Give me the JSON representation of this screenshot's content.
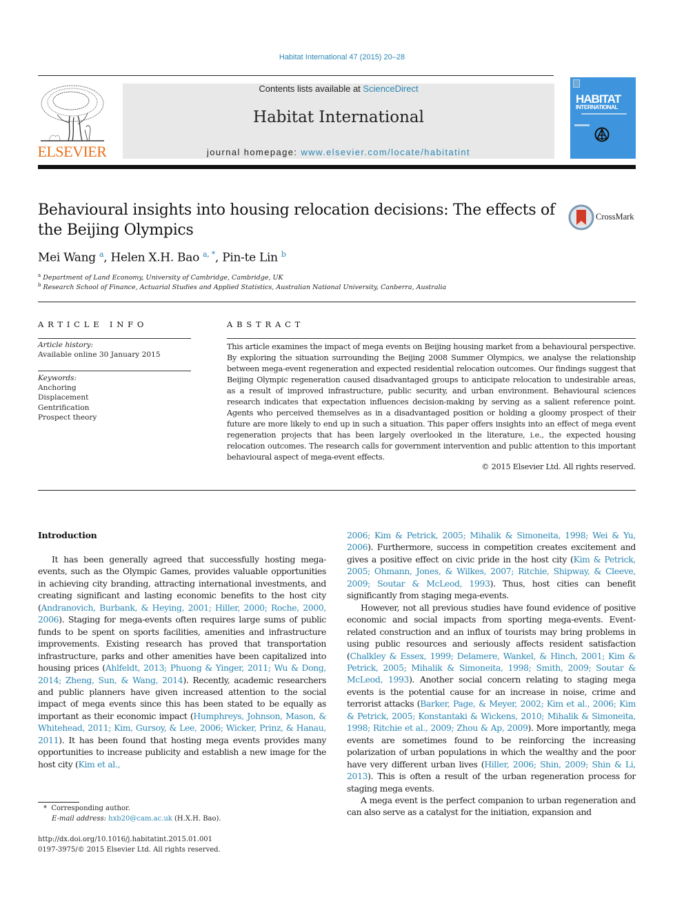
{
  "running_head": "Habitat International 47 (2015) 20–28",
  "masthead": {
    "publisher_logo_text": "ELSEVIER",
    "contents_prefix": "Contents lists available at ",
    "contents_link": "ScienceDirect",
    "journal_name": "Habitat International",
    "homepage_prefix": "journal homepage: ",
    "homepage_link": "www.elsevier.com/locate/habitatint",
    "cover_title": "HABITAT",
    "cover_subtitle": "INTERNATIONAL",
    "colors": {
      "link": "#2a86b2",
      "elsevier_orange": "#e9711c",
      "cover_blue": "#3f95dd",
      "masthead_gray": "#e8e8e8"
    }
  },
  "article": {
    "title_line1": "Behavioural insights into housing relocation decisions: The effects of",
    "title_line2": "the Beijing Olympics",
    "crossmark_label": "CrossMark",
    "authors": [
      {
        "name": "Mei Wang",
        "sup": "a",
        "sep": ", "
      },
      {
        "name": "Helen X.H. Bao",
        "sup": "a, *",
        "sep": ", "
      },
      {
        "name": "Pin-te Lin",
        "sup": "b",
        "sep": ""
      }
    ],
    "affiliations": [
      {
        "mark": "a",
        "text": "Department of Land Economy, University of Cambridge, Cambridge, UK"
      },
      {
        "mark": "b",
        "text": "Research School of Finance, Actuarial Studies and Applied Statistics, Australian National University, Canberra, Australia"
      }
    ]
  },
  "article_info": {
    "heading": "ARTICLE INFO",
    "history_label": "Article history:",
    "history_value": "Available online 30 January 2015",
    "keywords_label": "Keywords:",
    "keywords": [
      "Anchoring",
      "Displacement",
      "Gentrification",
      "Prospect theory"
    ]
  },
  "abstract": {
    "heading": "ABSTRACT",
    "text": "This article examines the impact of mega events on Beijing housing market from a behavioural perspective. By exploring the situation surrounding the Beijing 2008 Summer Olympics, we analyse the relationship between mega-event regeneration and expected residential relocation outcomes. Our findings suggest that Beijing Olympic regeneration caused disadvantaged groups to anticipate relocation to undesirable areas, as a result of improved infrastructure, public security, and urban environment. Behavioural sciences research indicates that expectation influences decision-making by serving as a salient reference point. Agents who perceived themselves as in a disadvantaged position or holding a gloomy prospect of their future are more likely to end up in such a situation. This paper offers insights into an effect of mega event regeneration projects that has been largely overlooked in the literature, i.e., the expected housing relocation outcomes. The research calls for government intervention and public attention to this important behavioural aspect of mega-event effects.",
    "copyright": "© 2015 Elsevier Ltd. All rights reserved."
  },
  "introduction": {
    "heading": "Introduction",
    "left_paragraph": [
      {
        "t": "It has been generally agreed that successfully hosting mega-events, such as the Olympic Games, provides valuable opportunities in achieving city branding, attracting international investments, and creating significant and lasting economic benefits to the host city ("
      },
      {
        "c": "Andranovich, Burbank, & Heying, 2001; Hiller, 2000; Roche, 2000, 2006"
      },
      {
        "t": "). Staging for mega-events often requires large sums of public funds to be spent on sports facilities, amenities and infrastructure improvements. Existing research has proved that transportation infrastructure, parks and other amenities have been capitalized into housing prices ("
      },
      {
        "c": "Ahlfeldt, 2013; Phuong & Yinger, 2011; Wu & Dong, 2014; Zheng, Sun, & Wang, 2014"
      },
      {
        "t": "). Recently, academic researchers and public planners have given increased attention to the social impact of mega events since this has been stated to be equally as important as their economic impact ("
      },
      {
        "c": "Humphreys, Johnson, Mason, & Whitehead, 2011; Kim, Gursoy, & Lee, 2006; Wicker, Prinz, & Hanau, 2011"
      },
      {
        "t": "). It has been found that hosting mega events provides many opportunities to increase publicity and establish a new image for the host city ("
      },
      {
        "c": "Kim et al.,"
      }
    ],
    "right_paragraphs": [
      [
        {
          "c": "2006; Kim & Petrick, 2005; Mihalik & Simoneita, 1998; Wei & Yu, 2006"
        },
        {
          "t": "). Furthermore, success in competition creates excitement and gives a positive effect on civic pride in the host city ("
        },
        {
          "c": "Kim & Petrick, 2005; Ohmann, Jones, & Wilkes, 2007; Ritchie, Shipway, & Cleeve, 2009; Soutar & McLeod, 1993"
        },
        {
          "t": "). Thus, host cities can benefit significantly from staging mega-events."
        }
      ],
      [
        {
          "t": "However, not all previous studies have found evidence of positive economic and social impacts from sporting mega-events. Event-related construction and an influx of tourists may bring problems in using public resources and seriously affects resident satisfaction ("
        },
        {
          "c": "Chalkley & Essex, 1999; Delamere, Wankel, & Hinch, 2001; Kim & Petrick, 2005; Mihalik & Simoneita, 1998; Smith, 2009; Soutar & McLeod, 1993"
        },
        {
          "t": "). Another social concern relating to staging mega events is the potential cause for an increase in noise, crime and terrorist attacks ("
        },
        {
          "c": "Barker, Page, & Meyer, 2002; Kim et al., 2006; Kim & Petrick, 2005; Konstantaki & Wickens, 2010; Mihalik & Simoneita, 1998; Ritchie et al., 2009; Zhou & Ap, 2009"
        },
        {
          "t": "). More importantly, mega events are sometimes found to be reinforcing the increasing polarization of urban populations in which the wealthy and the poor have very different urban lives ("
        },
        {
          "c": "Hiller, 2006; Shin, 2009; Shin & Li, 2013"
        },
        {
          "t": "). This is often a result of the urban regeneration process for staging mega events."
        }
      ],
      [
        {
          "t": "A mega event is the perfect companion to urban regeneration and can also serve as a catalyst for the initiation, expansion and"
        }
      ]
    ]
  },
  "footnotes": {
    "corresponding_mark": "*",
    "corresponding_text": "Corresponding author.",
    "email_label": "E-mail address:",
    "email": "hxb20@cam.ac.uk",
    "email_suffix": " (H.X.H. Bao).",
    "doi": "http://dx.doi.org/10.1016/j.habitatint.2015.01.001",
    "issn_line": "0197-3975/© 2015 Elsevier Ltd. All rights reserved."
  }
}
